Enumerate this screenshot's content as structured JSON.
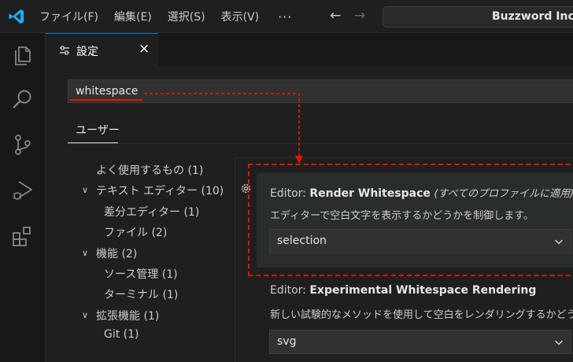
{
  "menu": {
    "items": [
      "ファイル(F)",
      "編集(E)",
      "選択(S)",
      "表示(V)"
    ],
    "more": "···"
  },
  "command_center": {
    "label": "Buzzword Inc."
  },
  "tab": {
    "label": "設定",
    "close": "×"
  },
  "search": {
    "value": "whitespace"
  },
  "scope": {
    "user_tab": "ユーザー"
  },
  "toc": {
    "commonly_used": "よく使用するもの (1)",
    "text_editor": "テキスト エディター (10)",
    "diff_editor": "差分エディター (1)",
    "files": "ファイル (2)",
    "features": "機能 (2)",
    "scm": "ソース管理 (1)",
    "terminal": "ターミナル (1)",
    "extensions": "拡張機能 (1)",
    "git": "Git (1)"
  },
  "settings": [
    {
      "category": "Editor: ",
      "name": "Render Whitespace",
      "note": "(すべてのプロファイルに適用)",
      "description": "エディターで空白文字を表示するかどうかを制御します。",
      "value": "selection"
    },
    {
      "category": "Editor: ",
      "name": "Experimental Whitespace Rendering",
      "description": "新しい試験的なメソッドを使用して空白をレンダリングするかどうか",
      "value": "svg"
    }
  ],
  "colors": {
    "accent": "#0078d4",
    "annotation": "#e51400",
    "logo": "#23a9f2"
  }
}
